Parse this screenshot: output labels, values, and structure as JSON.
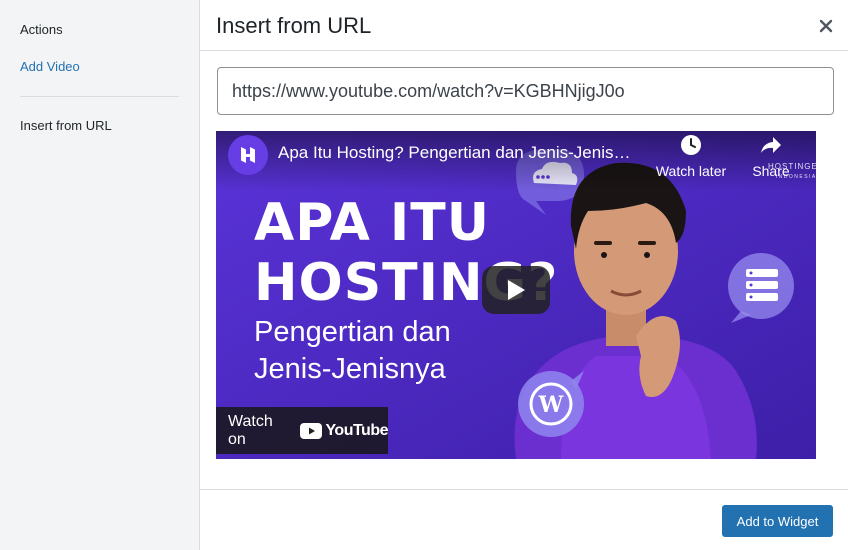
{
  "sidebar": {
    "heading": "Actions",
    "link": "Add Video",
    "current": "Insert from URL"
  },
  "modal": {
    "title": "Insert from URL",
    "close_icon": "close-icon"
  },
  "url_input": {
    "value": "https://www.youtube.com/watch?v=KGBHNjigJ0o"
  },
  "video": {
    "title": "Apa Itu Hosting? Pengertian dan Jenis-Jenis…",
    "watch_later": "Watch later",
    "share": "Share",
    "brand": "HOSTINGER",
    "brand_sub": "INDONESIA",
    "headline_line1": "APA ITU",
    "headline_line2": "HOSTING?",
    "subline_1": "Pengertian dan",
    "subline_2": "Jenis-Jenisnya",
    "watch_on": "Watch on",
    "youtube_word": "YouTube",
    "icons": [
      "clock-icon",
      "share-icon",
      "play-icon",
      "cloud-icon",
      "server-icon",
      "wordpress-icon",
      "youtube-logo-icon",
      "hostinger-logo-icon"
    ]
  },
  "footer": {
    "button": "Add to Widget"
  },
  "colors": {
    "accent": "#2271b1",
    "sidebar_bg": "#f3f4f5",
    "thumbnail_purple": "#5b35d5"
  }
}
